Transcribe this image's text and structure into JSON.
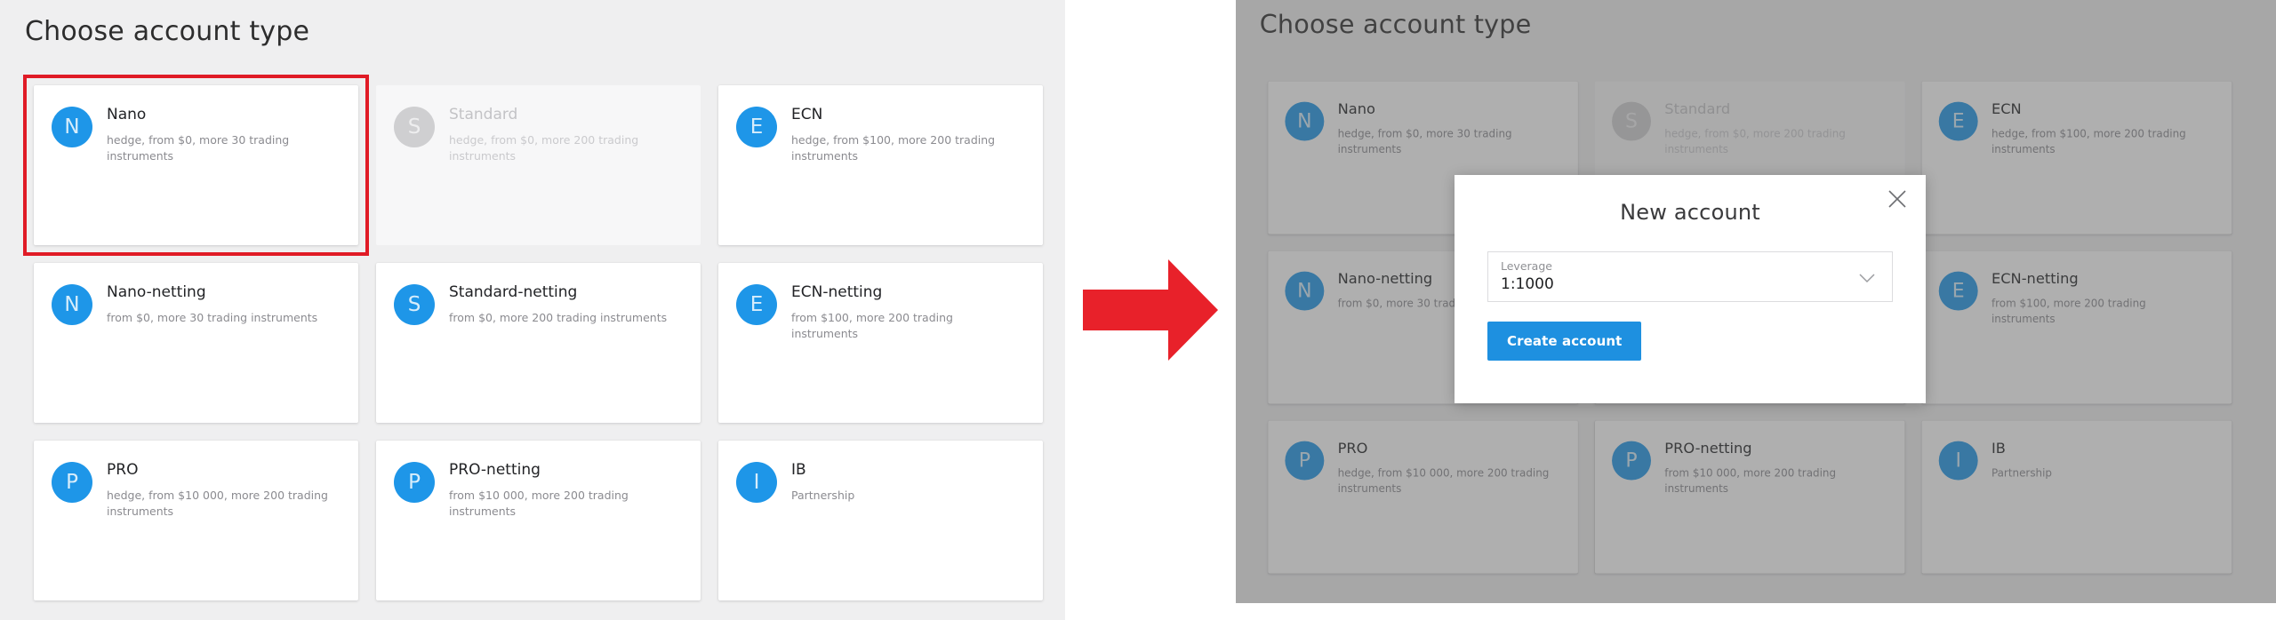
{
  "page": {
    "title": "Choose account type"
  },
  "accounts": [
    {
      "initial": "N",
      "name": "Nano",
      "description": "hedge, from $0, more 30 trading instruments",
      "disabled": false,
      "selected": true
    },
    {
      "initial": "S",
      "name": "Standard",
      "description": "hedge, from $0, more 200 trading instruments",
      "disabled": true,
      "selected": false
    },
    {
      "initial": "E",
      "name": "ECN",
      "description": "hedge, from $100, more 200 trading instruments",
      "disabled": false,
      "selected": false
    },
    {
      "initial": "N",
      "name": "Nano-netting",
      "description": "from $0, more 30 trading instruments",
      "disabled": false,
      "selected": false
    },
    {
      "initial": "S",
      "name": "Standard-netting",
      "description": "from $0, more 200 trading instruments",
      "disabled": false,
      "selected": false
    },
    {
      "initial": "E",
      "name": "ECN-netting",
      "description": "from $100, more 200 trading instruments",
      "disabled": false,
      "selected": false
    },
    {
      "initial": "P",
      "name": "PRO",
      "description": "hedge, from $10 000, more 200 trading instruments",
      "disabled": false,
      "selected": false
    },
    {
      "initial": "P",
      "name": "PRO-netting",
      "description": "from $10 000, more 200 trading instruments",
      "disabled": false,
      "selected": false
    },
    {
      "initial": "I",
      "name": "IB",
      "description": "Partnership",
      "disabled": false,
      "selected": false
    }
  ],
  "modal": {
    "title": "New account",
    "close_icon": "close-icon",
    "leverage": {
      "label": "Leverage",
      "value": "1:1000",
      "chevron_icon": "chevron-down-icon"
    },
    "create_button": "Create account"
  },
  "arrow": {
    "icon": "arrow-right-icon"
  },
  "colors": {
    "accent_blue": "#1e90e0",
    "avatar_blue": "#1e96e8",
    "avatar_disabled": "#cfcfd1",
    "highlight_red": "#e01b26",
    "arrow_red": "#e8212a",
    "panel_background": "#efeff0",
    "card_background": "#ffffff"
  }
}
